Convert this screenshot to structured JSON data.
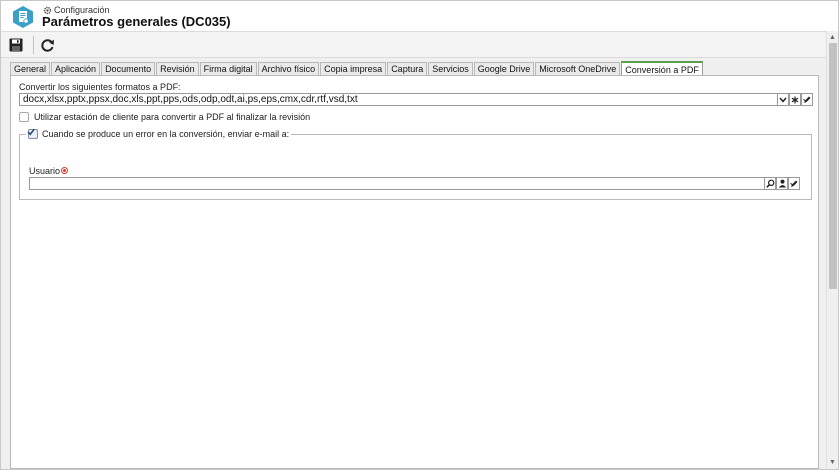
{
  "header": {
    "breadcrumb": "Configuración",
    "title": "Parámetros generales (DC035)"
  },
  "toolbar": {
    "buttons": [
      {
        "icon": "save-icon"
      },
      {
        "icon": "refresh-icon"
      }
    ]
  },
  "tabs": [
    {
      "label": "General"
    },
    {
      "label": "Aplicación"
    },
    {
      "label": "Documento"
    },
    {
      "label": "Revisión"
    },
    {
      "label": "Firma digital"
    },
    {
      "label": "Archivo físico"
    },
    {
      "label": "Copia impresa"
    },
    {
      "label": "Captura"
    },
    {
      "label": "Servicios"
    },
    {
      "label": "Google Drive"
    },
    {
      "label": "Microsoft OneDrive"
    },
    {
      "label": "Conversión a PDF",
      "active": true
    }
  ],
  "form": {
    "formats_label": "Convertir los siguientes formatos a PDF:",
    "formats_value": "docx,xlsx,pptx,ppsx,doc,xls,ppt,pps,ods,odp,odt,ai,ps,eps,cmx,cdr,rtf,vsd,txt",
    "client_station_label": "Utilizar estación de cliente para convertir a PDF al finalizar la revisión",
    "client_station_checked": false,
    "error_email_label": "Cuando se produce un error en la conversión, enviar e-mail a:",
    "error_email_checked": true,
    "user_label": "Usuario",
    "user_value": ""
  },
  "colors": {
    "app_icon": "#3aa0c8",
    "active_tab_accent": "#5a9e4a",
    "required": "#e23b2b"
  }
}
